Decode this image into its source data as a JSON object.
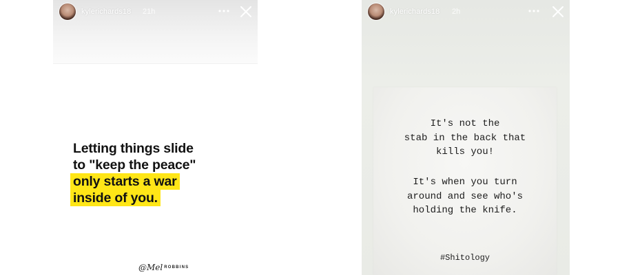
{
  "stories": [
    {
      "username": "kylerichards18",
      "timestamp": "21h",
      "more_icon": "more-horizontal-icon",
      "close_icon": "close-icon",
      "quote_lines": [
        "Letting things slide",
        "to \"keep the peace\""
      ],
      "quote_highlight_lines": [
        "only starts a war",
        "inside of you."
      ],
      "highlight_color": "#ffe617",
      "signature": {
        "script": "@Mel",
        "caps": "ROBBINS"
      }
    },
    {
      "username": "kylerichards18",
      "timestamp": "2h",
      "more_icon": "more-horizontal-icon",
      "close_icon": "close-icon",
      "card_para1": [
        "It's not the",
        "stab in the back that",
        "kills you!"
      ],
      "card_para2": [
        "It's when you turn",
        "around and see who's",
        "holding the knife."
      ],
      "hashtag": "#Shitology"
    }
  ]
}
